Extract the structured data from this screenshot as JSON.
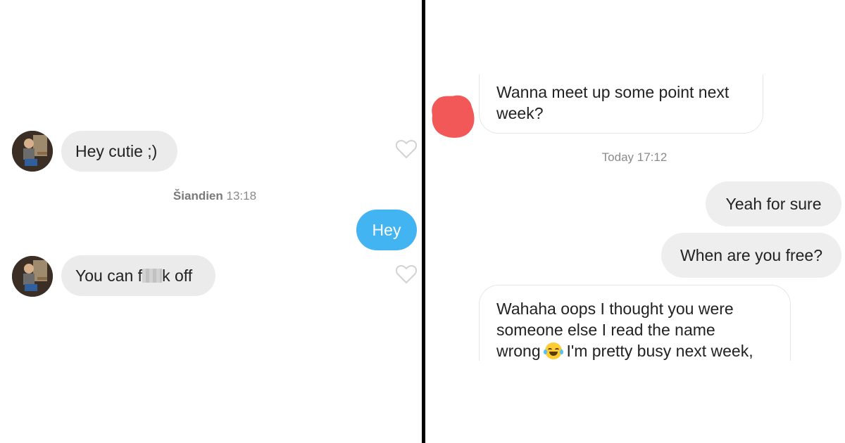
{
  "left_chat": {
    "messages": [
      {
        "text": "Hey cutie ;)",
        "side": "incoming"
      },
      {
        "text": "Hey",
        "side": "outgoing"
      },
      {
        "text_before": "You can f",
        "text_after": "k off",
        "side": "incoming"
      }
    ],
    "timestamp_label": "Šiandien",
    "timestamp_time": "13:18"
  },
  "right_chat": {
    "messages": [
      {
        "text_line1": "Wanna meet up some point next",
        "text_line2": "week?",
        "side": "incoming"
      },
      {
        "text": "Yeah for sure",
        "side": "outgoing"
      },
      {
        "text": "When are you free?",
        "side": "outgoing"
      },
      {
        "text_line1": "Wahaha oops I thought you were",
        "text_line2": "someone else I read the name",
        "text_line3_before": "wrong",
        "text_line3_after": "I'm pretty busy next week,",
        "side": "incoming"
      }
    ],
    "timestamp": "Today 17:12"
  },
  "icons": {
    "heart": "heart-outline-icon",
    "emoji": "tears-of-joy-emoji",
    "avatar": "profile-photo"
  },
  "colors": {
    "outgoing_blue": "#42b4f2",
    "bubble_grey": "#ebebeb",
    "redaction_red": "#f25858",
    "divider": "#000000"
  }
}
